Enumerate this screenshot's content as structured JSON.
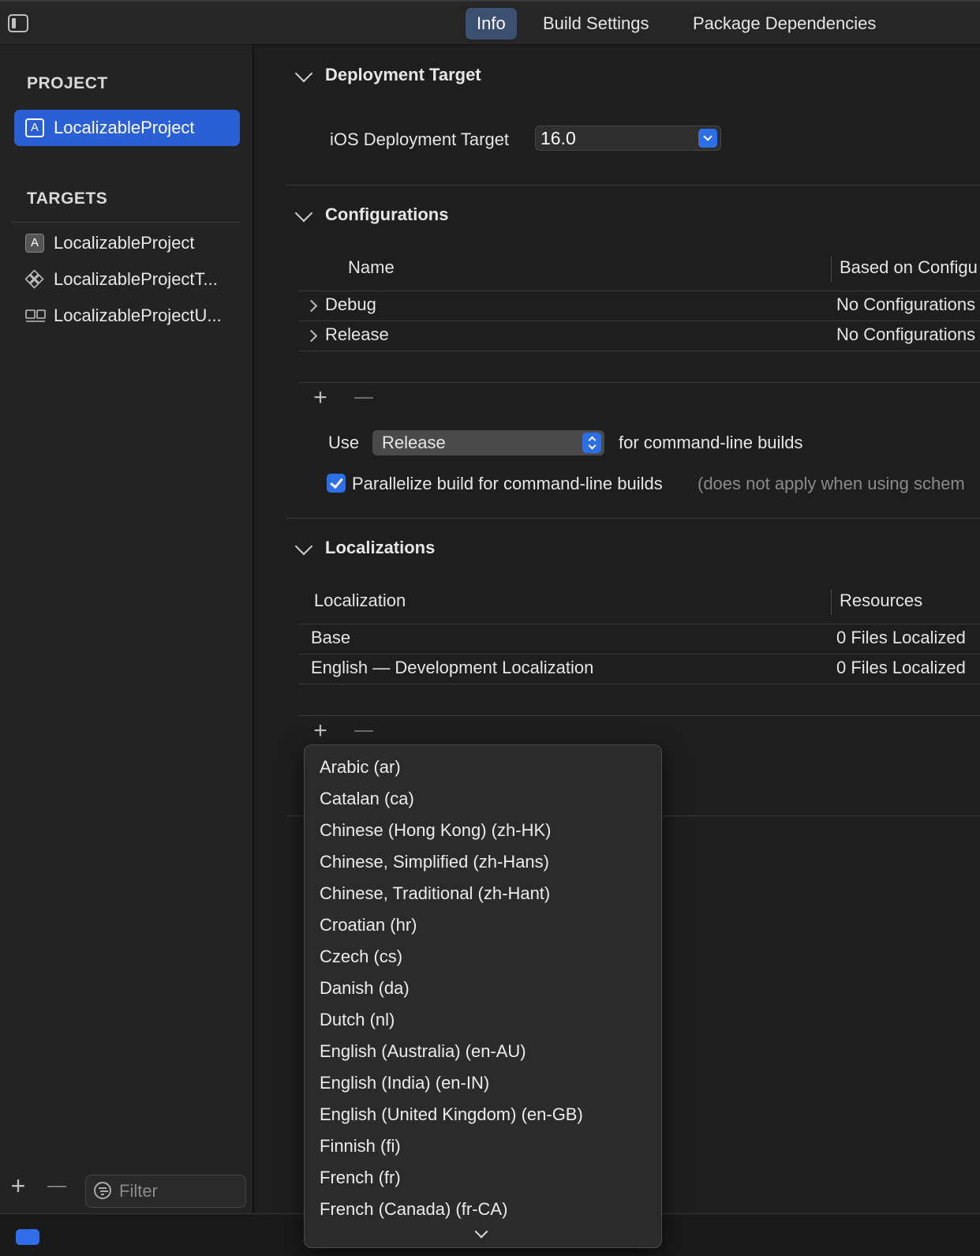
{
  "tabs": [
    {
      "label": "Info",
      "active": true
    },
    {
      "label": "Build Settings",
      "active": false
    },
    {
      "label": "Package Dependencies",
      "active": false
    }
  ],
  "sidebar": {
    "project_header": "PROJECT",
    "project_item": "LocalizableProject",
    "targets_header": "TARGETS",
    "targets": [
      {
        "label": "LocalizableProject",
        "icon": "app-icon"
      },
      {
        "label": "LocalizableProjectT...",
        "icon": "test-bundle-icon"
      },
      {
        "label": "LocalizableProjectU...",
        "icon": "ui-test-icon"
      }
    ],
    "filter_placeholder": "Filter"
  },
  "deployment": {
    "title": "Deployment Target",
    "ios_label": "iOS Deployment Target",
    "ios_value": "16.0"
  },
  "configurations": {
    "title": "Configurations",
    "col_name": "Name",
    "col_based": "Based on Configu",
    "rows": [
      {
        "name": "Debug",
        "based": "No Configurations"
      },
      {
        "name": "Release",
        "based": "No Configurations"
      }
    ],
    "use_label": "Use",
    "use_value": "Release",
    "use_suffix": "for command-line builds",
    "parallelize_label": "Parallelize build for command-line builds",
    "parallelize_note": "(does not apply when using schem",
    "parallelize_checked": true
  },
  "localizations": {
    "title": "Localizations",
    "col_localization": "Localization",
    "col_resources": "Resources",
    "rows": [
      {
        "name": "Base",
        "resources": "0 Files Localized"
      },
      {
        "name": "English — Development Localization",
        "resources": "0 Files Localized"
      }
    ]
  },
  "language_menu": {
    "items": [
      "Arabic (ar)",
      "Catalan (ca)",
      "Chinese (Hong Kong) (zh-HK)",
      "Chinese, Simplified (zh-Hans)",
      "Chinese, Traditional (zh-Hant)",
      "Croatian (hr)",
      "Czech (cs)",
      "Danish (da)",
      "Dutch (nl)",
      "English (Australia) (en-AU)",
      "English (India) (en-IN)",
      "English (United Kingdom) (en-GB)",
      "Finnish (fi)",
      "French (fr)",
      "French (Canada) (fr-CA)"
    ]
  },
  "colors": {
    "accent": "#2c6fe6",
    "selection": "#2a5fd6",
    "active_tab": "#3b4f70",
    "background": "#1e1e1e"
  }
}
